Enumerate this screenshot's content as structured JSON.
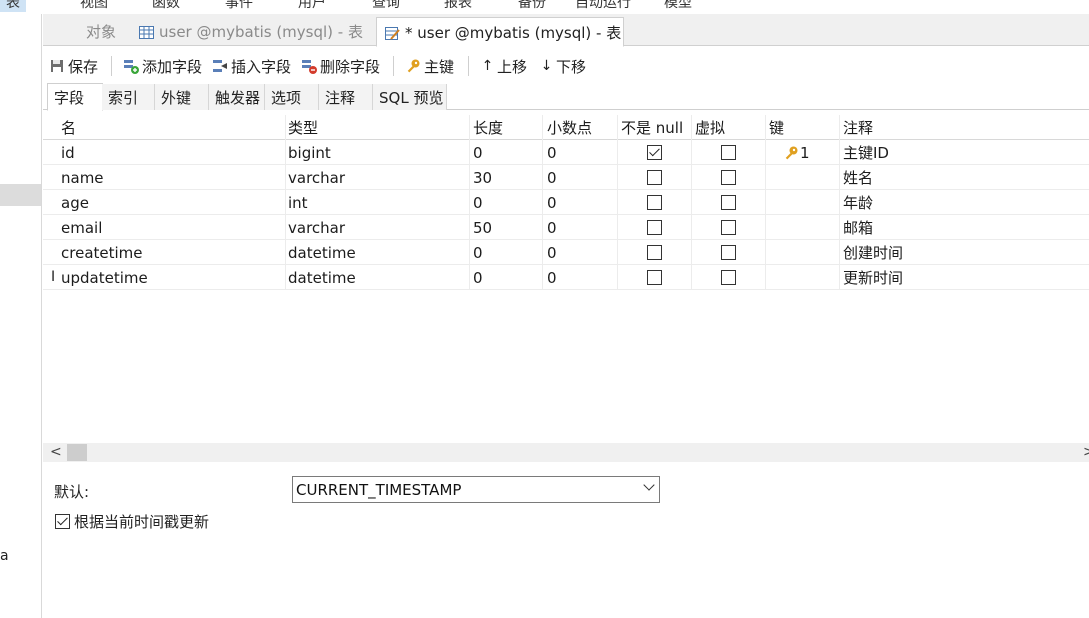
{
  "menu": [
    "表",
    "视图",
    "函数",
    "事件",
    "用户",
    "查询",
    "报表",
    "备份",
    "自动运行",
    "模型"
  ],
  "sidebar": {
    "cut_letter": "a"
  },
  "tabs": [
    {
      "label": "对象"
    },
    {
      "label": "user @mybatis (mysql) - 表"
    },
    {
      "label": "* user @mybatis (mysql) - 表"
    }
  ],
  "toolbar": {
    "save": "保存",
    "add_field": "添加字段",
    "insert_field": "插入字段",
    "delete_field": "删除字段",
    "primary_key": "主键",
    "move_up": "上移",
    "move_down": "下移"
  },
  "subtabs": [
    "字段",
    "索引",
    "外键",
    "触发器",
    "选项",
    "注释",
    "SQL 预览"
  ],
  "columns": [
    "名",
    "类型",
    "长度",
    "小数点",
    "不是 null",
    "虚拟",
    "键",
    "注释"
  ],
  "rows": [
    {
      "name": "id",
      "type": "bigint",
      "length": "0",
      "decimals": "0",
      "not_null": true,
      "virtual": false,
      "key": "1",
      "comment": "主键ID"
    },
    {
      "name": "name",
      "type": "varchar",
      "length": "30",
      "decimals": "0",
      "not_null": false,
      "virtual": false,
      "key": "",
      "comment": "姓名"
    },
    {
      "name": "age",
      "type": "int",
      "length": "0",
      "decimals": "0",
      "not_null": false,
      "virtual": false,
      "key": "",
      "comment": "年龄"
    },
    {
      "name": "email",
      "type": "varchar",
      "length": "50",
      "decimals": "0",
      "not_null": false,
      "virtual": false,
      "key": "",
      "comment": "邮箱"
    },
    {
      "name": "createtime",
      "type": "datetime",
      "length": "0",
      "decimals": "0",
      "not_null": false,
      "virtual": false,
      "key": "",
      "comment": "创建时间"
    },
    {
      "name": "updatetime",
      "type": "datetime",
      "length": "0",
      "decimals": "0",
      "not_null": false,
      "virtual": false,
      "key": "",
      "comment": "更新时间"
    }
  ],
  "scroll": {
    "left": "<",
    "right": ">"
  },
  "props": {
    "default_label": "默认:",
    "default_value": "CURRENT_TIMESTAMP",
    "update_on_current": "根据当前时间戳更新",
    "update_checked": true
  },
  "colors": {
    "key_icon": "#e0a020",
    "tab_bg": "#f0f0f0",
    "selection": "#cfe3f5"
  }
}
